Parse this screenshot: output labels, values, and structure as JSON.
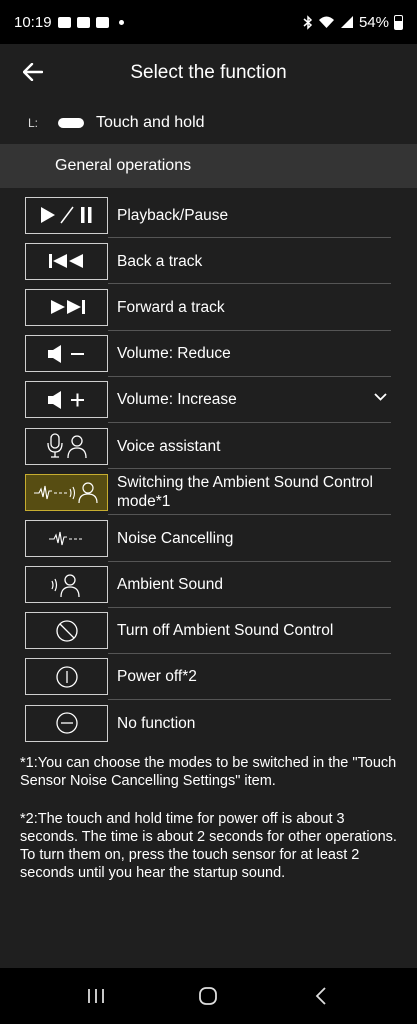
{
  "status": {
    "time": "10:19",
    "battery": "54%"
  },
  "appbar": {
    "title": "Select the function"
  },
  "assignment": {
    "side_label": "L:",
    "gesture": "Touch and hold"
  },
  "section": {
    "title": "General operations"
  },
  "functions": [
    {
      "label": "Playback/Pause",
      "icon": "play-pause-icon"
    },
    {
      "label": "Back a track",
      "icon": "previous-track-icon"
    },
    {
      "label": "Forward a track",
      "icon": "next-track-icon"
    },
    {
      "label": "Volume: Reduce",
      "icon": "volume-down-icon"
    },
    {
      "label": "Volume: Increase",
      "icon": "volume-up-icon"
    },
    {
      "label": "Voice assistant",
      "icon": "voice-assistant-icon"
    },
    {
      "label": "Switching the Ambient Sound Control mode*1",
      "icon": "ambient-switch-icon",
      "selected": true
    },
    {
      "label": "Noise Cancelling",
      "icon": "noise-cancelling-icon"
    },
    {
      "label": "Ambient Sound",
      "icon": "ambient-sound-icon"
    },
    {
      "label": "Turn off Ambient Sound Control",
      "icon": "ambient-off-icon"
    },
    {
      "label": "Power off*2",
      "icon": "power-off-icon"
    },
    {
      "label": "No function",
      "icon": "no-function-icon"
    }
  ],
  "notes": {
    "note1": "*1:You can choose the modes to be switched in the \"Touch Sensor Noise Cancelling Settings\" item.",
    "note2_line1": "*2:The touch and hold time for power off is about 3 seconds. The time is about 2 seconds for other operations.",
    "note2_line2": "To turn them on, press the touch sensor for at least 2 seconds until you hear the startup sound."
  },
  "colors": {
    "background": "#1f1f1f",
    "section": "#343434",
    "selected_fill": "#574d12",
    "selected_border": "#c6ad30"
  }
}
